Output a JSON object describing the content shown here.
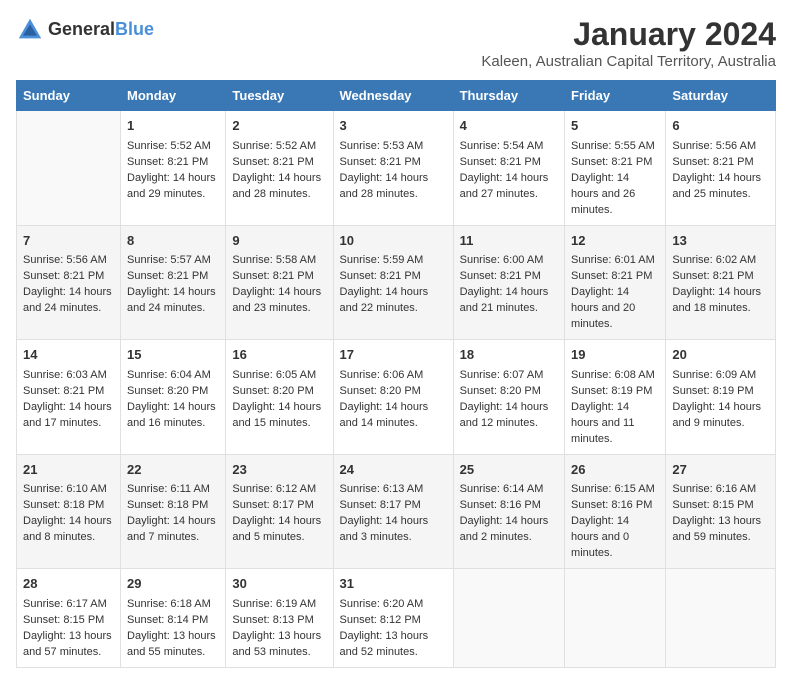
{
  "logo": {
    "general": "General",
    "blue": "Blue"
  },
  "title": "January 2024",
  "subtitle": "Kaleen, Australian Capital Territory, Australia",
  "days_of_week": [
    "Sunday",
    "Monday",
    "Tuesday",
    "Wednesday",
    "Thursday",
    "Friday",
    "Saturday"
  ],
  "weeks": [
    [
      {
        "day": "",
        "content": ""
      },
      {
        "day": "1",
        "content": "Sunrise: 5:52 AM\nSunset: 8:21 PM\nDaylight: 14 hours and 29 minutes."
      },
      {
        "day": "2",
        "content": "Sunrise: 5:52 AM\nSunset: 8:21 PM\nDaylight: 14 hours and 28 minutes."
      },
      {
        "day": "3",
        "content": "Sunrise: 5:53 AM\nSunset: 8:21 PM\nDaylight: 14 hours and 28 minutes."
      },
      {
        "day": "4",
        "content": "Sunrise: 5:54 AM\nSunset: 8:21 PM\nDaylight: 14 hours and 27 minutes."
      },
      {
        "day": "5",
        "content": "Sunrise: 5:55 AM\nSunset: 8:21 PM\nDaylight: 14 hours and 26 minutes."
      },
      {
        "day": "6",
        "content": "Sunrise: 5:56 AM\nSunset: 8:21 PM\nDaylight: 14 hours and 25 minutes."
      }
    ],
    [
      {
        "day": "7",
        "content": "Sunrise: 5:56 AM\nSunset: 8:21 PM\nDaylight: 14 hours and 24 minutes."
      },
      {
        "day": "8",
        "content": "Sunrise: 5:57 AM\nSunset: 8:21 PM\nDaylight: 14 hours and 24 minutes."
      },
      {
        "day": "9",
        "content": "Sunrise: 5:58 AM\nSunset: 8:21 PM\nDaylight: 14 hours and 23 minutes."
      },
      {
        "day": "10",
        "content": "Sunrise: 5:59 AM\nSunset: 8:21 PM\nDaylight: 14 hours and 22 minutes."
      },
      {
        "day": "11",
        "content": "Sunrise: 6:00 AM\nSunset: 8:21 PM\nDaylight: 14 hours and 21 minutes."
      },
      {
        "day": "12",
        "content": "Sunrise: 6:01 AM\nSunset: 8:21 PM\nDaylight: 14 hours and 20 minutes."
      },
      {
        "day": "13",
        "content": "Sunrise: 6:02 AM\nSunset: 8:21 PM\nDaylight: 14 hours and 18 minutes."
      }
    ],
    [
      {
        "day": "14",
        "content": "Sunrise: 6:03 AM\nSunset: 8:21 PM\nDaylight: 14 hours and 17 minutes."
      },
      {
        "day": "15",
        "content": "Sunrise: 6:04 AM\nSunset: 8:20 PM\nDaylight: 14 hours and 16 minutes."
      },
      {
        "day": "16",
        "content": "Sunrise: 6:05 AM\nSunset: 8:20 PM\nDaylight: 14 hours and 15 minutes."
      },
      {
        "day": "17",
        "content": "Sunrise: 6:06 AM\nSunset: 8:20 PM\nDaylight: 14 hours and 14 minutes."
      },
      {
        "day": "18",
        "content": "Sunrise: 6:07 AM\nSunset: 8:20 PM\nDaylight: 14 hours and 12 minutes."
      },
      {
        "day": "19",
        "content": "Sunrise: 6:08 AM\nSunset: 8:19 PM\nDaylight: 14 hours and 11 minutes."
      },
      {
        "day": "20",
        "content": "Sunrise: 6:09 AM\nSunset: 8:19 PM\nDaylight: 14 hours and 9 minutes."
      }
    ],
    [
      {
        "day": "21",
        "content": "Sunrise: 6:10 AM\nSunset: 8:18 PM\nDaylight: 14 hours and 8 minutes."
      },
      {
        "day": "22",
        "content": "Sunrise: 6:11 AM\nSunset: 8:18 PM\nDaylight: 14 hours and 7 minutes."
      },
      {
        "day": "23",
        "content": "Sunrise: 6:12 AM\nSunset: 8:17 PM\nDaylight: 14 hours and 5 minutes."
      },
      {
        "day": "24",
        "content": "Sunrise: 6:13 AM\nSunset: 8:17 PM\nDaylight: 14 hours and 3 minutes."
      },
      {
        "day": "25",
        "content": "Sunrise: 6:14 AM\nSunset: 8:16 PM\nDaylight: 14 hours and 2 minutes."
      },
      {
        "day": "26",
        "content": "Sunrise: 6:15 AM\nSunset: 8:16 PM\nDaylight: 14 hours and 0 minutes."
      },
      {
        "day": "27",
        "content": "Sunrise: 6:16 AM\nSunset: 8:15 PM\nDaylight: 13 hours and 59 minutes."
      }
    ],
    [
      {
        "day": "28",
        "content": "Sunrise: 6:17 AM\nSunset: 8:15 PM\nDaylight: 13 hours and 57 minutes."
      },
      {
        "day": "29",
        "content": "Sunrise: 6:18 AM\nSunset: 8:14 PM\nDaylight: 13 hours and 55 minutes."
      },
      {
        "day": "30",
        "content": "Sunrise: 6:19 AM\nSunset: 8:13 PM\nDaylight: 13 hours and 53 minutes."
      },
      {
        "day": "31",
        "content": "Sunrise: 6:20 AM\nSunset: 8:12 PM\nDaylight: 13 hours and 52 minutes."
      },
      {
        "day": "",
        "content": ""
      },
      {
        "day": "",
        "content": ""
      },
      {
        "day": "",
        "content": ""
      }
    ]
  ]
}
